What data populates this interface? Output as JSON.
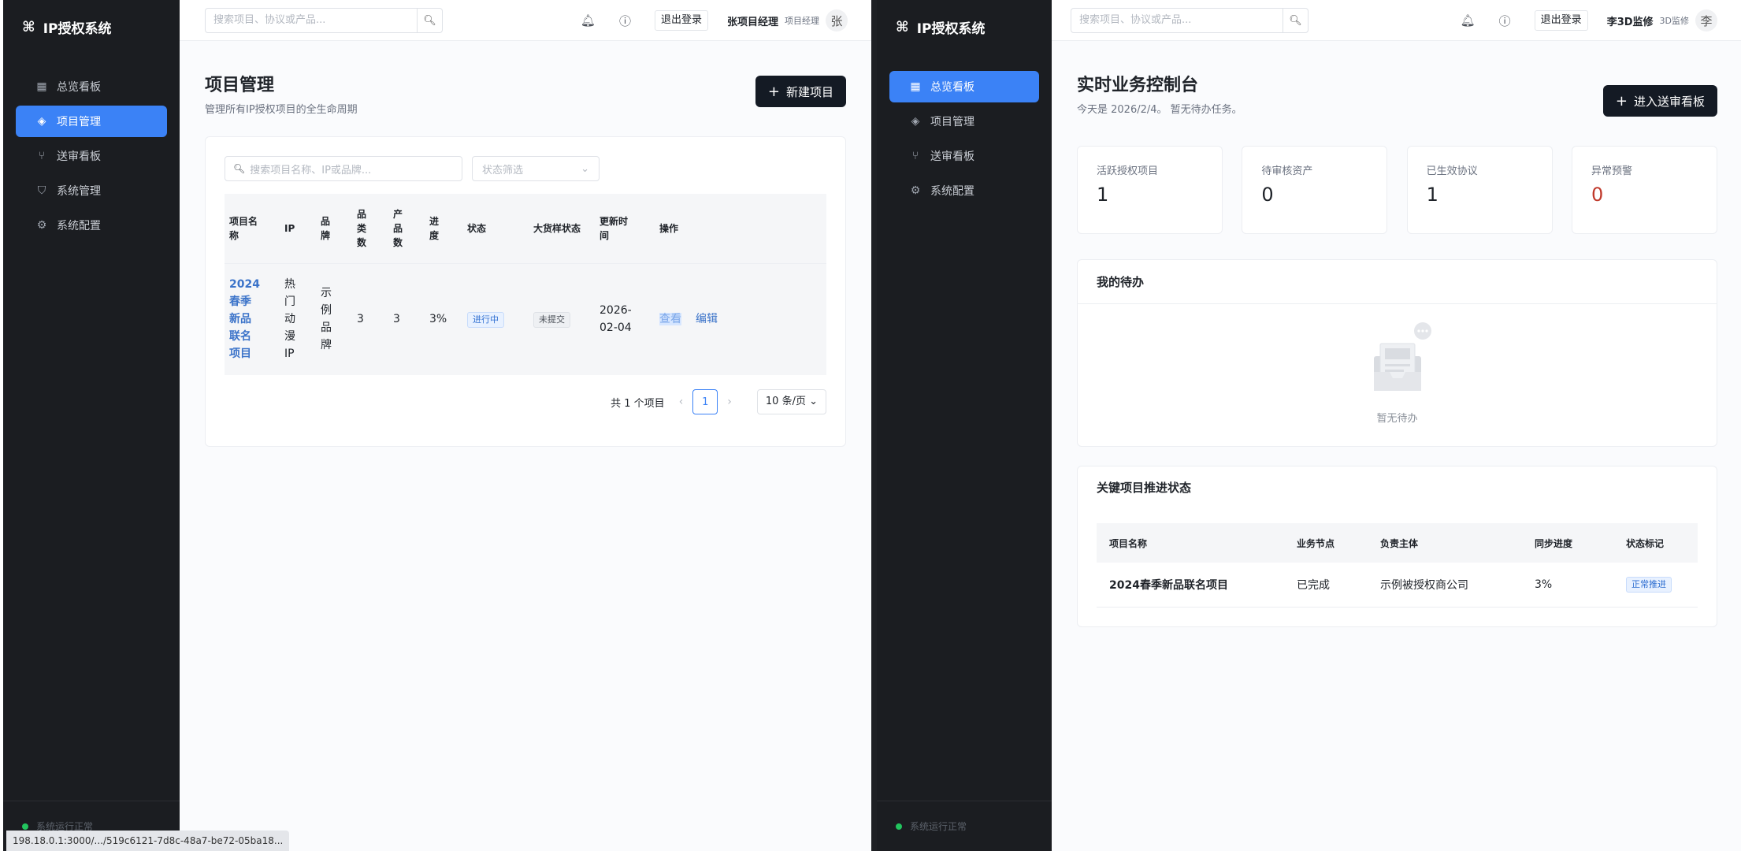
{
  "app": {
    "logo_icon": "⌘",
    "name": "IP授权系统"
  },
  "left": {
    "search_placeholder": "搜索项目、协议或产品...",
    "nav": [
      {
        "icon": "grid-icon",
        "glyph": "▦",
        "label": "总览看板"
      },
      {
        "icon": "layers-icon",
        "glyph": "◈",
        "label": "项目管理",
        "active": true
      },
      {
        "icon": "git-icon",
        "glyph": "⑂",
        "label": "送审看板"
      },
      {
        "icon": "shield-icon",
        "glyph": "⛉",
        "label": "系统管理"
      },
      {
        "icon": "gear-icon",
        "glyph": "⚙",
        "label": "系统配置"
      }
    ],
    "footer": "系统运行正常",
    "logout": "退出登录",
    "user_name": "张项目经理",
    "user_role": "项目经理",
    "avatar": "张",
    "title": "项目管理",
    "subtitle": "管理所有IP授权项目的全生命周期",
    "new_button": "新建项目",
    "filter_search_placeholder": "搜索项目名称、IP或品牌...",
    "filter_status_placeholder": "状态筛选",
    "columns": [
      "项目名称",
      "IP",
      "品牌",
      "品类数",
      "产品数",
      "进度",
      "状态",
      "大货样状态",
      "更新时间",
      "操作"
    ],
    "row": {
      "name": "2024春季新品联名项目",
      "ip": "热门动漫IP",
      "brand": "示例品牌",
      "category_count": "3",
      "product_count": "3",
      "progress": "3%",
      "status": "进行中",
      "sample_status": "未提交",
      "updated": "2026-02-04",
      "op_view": "查看",
      "op_edit": "编辑"
    },
    "pager": {
      "total": "共 1 个项目",
      "page": "1",
      "size": "10 条/页"
    },
    "status_url": "198.18.0.1:3000/.../519c6121-7d8c-48a7-be72-05ba18..."
  },
  "right": {
    "search_placeholder": "搜索项目、协议或产品...",
    "nav": [
      {
        "icon": "grid-icon",
        "glyph": "▦",
        "label": "总览看板",
        "active": true
      },
      {
        "icon": "layers-icon",
        "glyph": "◈",
        "label": "项目管理"
      },
      {
        "icon": "git-icon",
        "glyph": "⑂",
        "label": "送审看板"
      },
      {
        "icon": "gear-icon",
        "glyph": "⚙",
        "label": "系统配置"
      }
    ],
    "footer": "系统运行正常",
    "logout": "退出登录",
    "user_name": "李3D监修",
    "user_role": "3D监修",
    "avatar": "李",
    "title": "实时业务控制台",
    "subtitle": "今天是 2026/2/4。 暂无待办任务。",
    "enter_button": "进入送审看板",
    "stats": [
      {
        "label": "活跃授权项目",
        "value": "1"
      },
      {
        "label": "待审核资产",
        "value": "0"
      },
      {
        "label": "已生效协议",
        "value": "1"
      },
      {
        "label": "异常预警",
        "value": "0",
        "alert": true
      }
    ],
    "todo_title": "我的待办",
    "todo_empty": "暂无待办",
    "key_title": "关键项目推进状态",
    "key_columns": [
      "项目名称",
      "业务节点",
      "负责主体",
      "同步进度",
      "状态标记"
    ],
    "key_row": {
      "name": "2024春季新品联名项目",
      "node": "已完成",
      "owner": "示例被授权商公司",
      "progress": "3%",
      "status": "正常推进"
    }
  }
}
